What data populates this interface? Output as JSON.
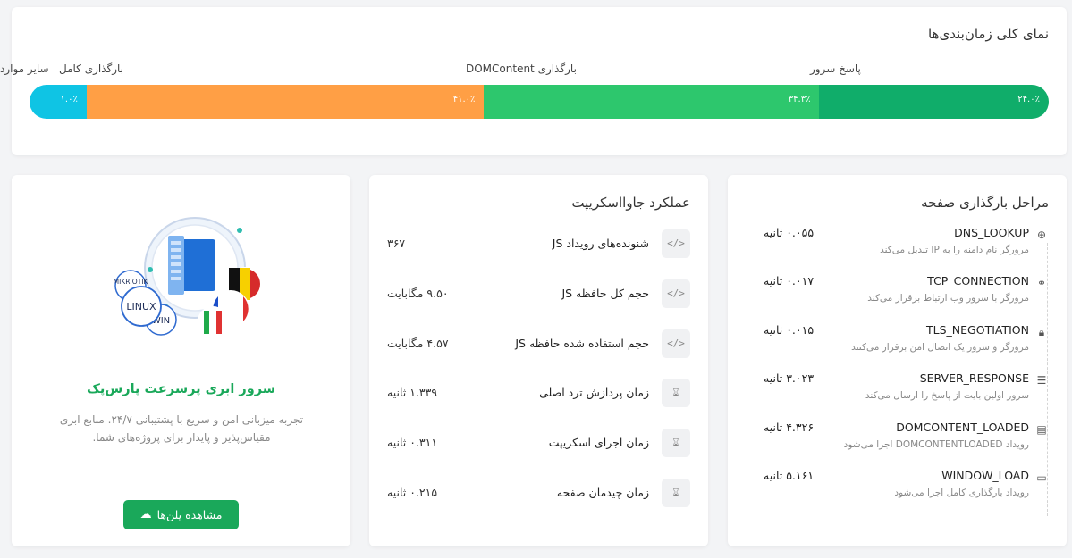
{
  "overview": {
    "title": "نمای کلی زمان‌بندی‌ها",
    "segments": [
      {
        "label": "سایر موارد",
        "percent_label": "۱.۰٪",
        "share": 5.6,
        "color": "#0fc4e4"
      },
      {
        "label": "بارگذاری کامل",
        "percent_label": "۴۱.۰٪",
        "share": 39.0,
        "color": "#ff9f45"
      },
      {
        "label": "بارگذاری DOMContent",
        "percent_label": "۳۴.۳٪",
        "share": 32.9,
        "color": "#2dc76d"
      },
      {
        "label": "پاسخ سرور",
        "percent_label": "۲۴.۰٪",
        "share": 22.5,
        "color": "#10ad6a"
      }
    ]
  },
  "stages": {
    "title": "مراحل بارگذاری صفحه",
    "items": [
      {
        "icon": "globe-icon",
        "glyph": "⊕",
        "name": "DNS_LOOKUP",
        "desc": "مرورگر نام دامنه را به IP تبدیل می‌کند",
        "value": "۰.۰۵۵ ثانیه"
      },
      {
        "icon": "link-icon",
        "glyph": "⚭",
        "name": "TCP_CONNECTION",
        "desc": "مرورگر با سرور وب ارتباط برقرار می‌کند",
        "value": "۰.۰۱۷ ثانیه"
      },
      {
        "icon": "lock-icon",
        "glyph": "🔒︎",
        "name": "TLS_NEGOTIATION",
        "desc": "مرورگر و سرور یک اتصال امن برقرار می‌کنند",
        "value": "۰.۰۱۵ ثانیه"
      },
      {
        "icon": "server-icon",
        "glyph": "☰",
        "name": "SERVER_RESPONSE",
        "desc": "سرور اولین بایت از پاسخ را ارسال می‌کند",
        "value": "۳.۰۲۳ ثانیه"
      },
      {
        "icon": "document-icon",
        "glyph": "▤",
        "name": "DOMCONTENT_LOADED",
        "desc": "رویداد DOMCONTENTLOADED اجرا می‌شود",
        "value": "۴.۳۲۶ ثانیه"
      },
      {
        "icon": "window-icon",
        "glyph": "▭",
        "name": "WINDOW_LOAD",
        "desc": "رویداد بارگذاری کامل اجرا می‌شود",
        "value": "۵.۱۶۱ ثانیه"
      }
    ]
  },
  "js": {
    "title": "عملکرد جاوااسکریپت",
    "rows": [
      {
        "icon": "code-icon",
        "glyph": "</>",
        "label": "شنونده‌های رویداد JS",
        "value": "۳۶۷"
      },
      {
        "icon": "code-icon",
        "glyph": "</>",
        "label": "حجم کل حافظه JS",
        "value": "۹.۵۰ مگابایت"
      },
      {
        "icon": "code-icon",
        "glyph": "</>",
        "label": "حجم استفاده شده حافظه JS",
        "value": "۴.۵۷ مگابایت"
      },
      {
        "icon": "hourglass-icon",
        "glyph": "⌛︎",
        "label": "زمان پردازش ترد اصلی",
        "value": "۱.۳۳۹ ثانیه"
      },
      {
        "icon": "hourglass-icon",
        "glyph": "⌛︎",
        "label": "زمان اجرای اسکریپت",
        "value": "۰.۳۱۱ ثانیه"
      },
      {
        "icon": "hourglass-icon",
        "glyph": "⌛︎",
        "label": "زمان چیدمان صفحه",
        "value": "۰.۲۱۵ ثانیه"
      }
    ]
  },
  "promo": {
    "illustration_labels": [
      "MIKR OTIK",
      "LINUX",
      "WIN"
    ],
    "title": "سرور ابری پرسرعت پارس‌پک",
    "desc": "تجربه میزبانی امن و سریع با پشتیبانی ۲۴/۷. منابع ابری مقیاس‌پذیر و پایدار برای پروژه‌های شما.",
    "button_label": "مشاهده پلن‌ها",
    "accent": "#1aa85a"
  }
}
